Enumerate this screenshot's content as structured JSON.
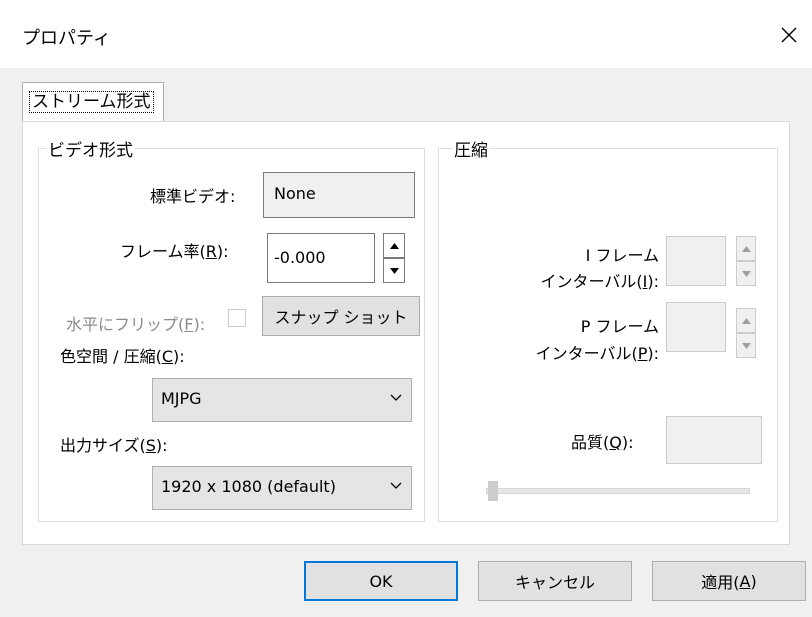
{
  "window": {
    "title": "プロパティ"
  },
  "tabs": [
    {
      "label": "ストリーム形式"
    }
  ],
  "video_format": {
    "group_title": "ビデオ形式",
    "standard_video_label": "標準ビデオ:",
    "standard_video_value": "None",
    "frame_rate_label": "フレーム率(",
    "frame_rate_key": "R",
    "frame_rate_suffix": "):",
    "frame_rate_value": "-0.000",
    "flip_label": "水平にフリップ(",
    "flip_key": "F",
    "flip_suffix": "):",
    "snapshot_label": "スナップ ショット",
    "color_space_label": "色空間 / 圧縮(",
    "color_space_key": "C",
    "color_space_suffix": "):",
    "color_space_value": "MJPG",
    "output_size_label": "出力サイズ(",
    "output_size_key": "S",
    "output_size_suffix": "):",
    "output_size_value": "1920 x 1080  (default)"
  },
  "compression": {
    "group_title": "圧縮",
    "i_frame_line1": "I フレーム",
    "i_frame_line2_prefix": "インターバル(",
    "i_frame_key": "I",
    "i_frame_suffix": "):",
    "p_frame_line1": "P フレーム",
    "p_frame_line2_prefix": "インターバル(",
    "p_frame_key": "P",
    "p_frame_suffix": "):",
    "quality_prefix": "品質(",
    "quality_key": "Q",
    "quality_suffix": "):"
  },
  "buttons": {
    "ok": "OK",
    "cancel": "キャンセル",
    "apply_prefix": "適用(",
    "apply_key": "A",
    "apply_suffix": ")"
  }
}
